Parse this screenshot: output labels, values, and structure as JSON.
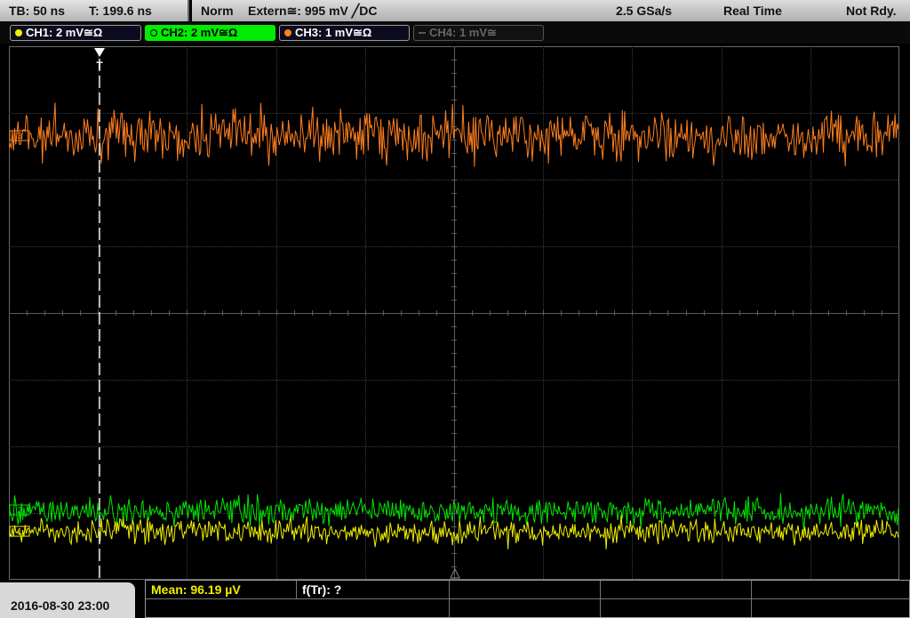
{
  "header": {
    "timebase": "TB: 50 ns",
    "trigger_time": "T: 199.6 ns",
    "trigger_mode": "Norm",
    "trigger_source": "Extern≅: 995 mV ╱DC",
    "sample_rate": "2.5 GSa/s",
    "acq_mode": "Real Time",
    "status": "Not Rdy."
  },
  "channels": [
    {
      "label": "CH1: 2 mV≅Ω",
      "color": "#f0f000"
    },
    {
      "label": "CH2: 2 mV≅Ω",
      "color": "#00e800"
    },
    {
      "label": "CH3: 1 mV≅Ω",
      "color": "#ff7f1e"
    },
    {
      "label": "CH4: 1 mV≅",
      "color": "#666666"
    }
  ],
  "footer": {
    "datetime": "2016-08-30 23:00",
    "measurement": "Mean: 96.19 µV",
    "function": "f(Tr): ?"
  },
  "markers": {
    "trigger": "T",
    "ch3_ground": "3",
    "ch2_ground": "2",
    "ch1_ground": "1"
  },
  "colors": {
    "grid": "#3c3c3c",
    "center_axis": "#5a5a5a",
    "background": "#000000"
  }
}
